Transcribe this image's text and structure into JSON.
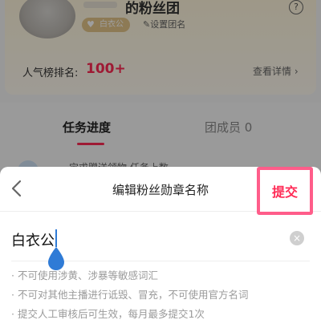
{
  "club": {
    "title": "的粉丝团",
    "badge_name": "白衣公",
    "set_name_link": "✎设置团名",
    "help_icon": "?",
    "rank_label": "人气榜排名:",
    "rank_value": "100+",
    "detail_link": "查看详情 ›"
  },
  "tabs": [
    {
      "label": "任务进度",
      "active": true
    },
    {
      "label": "团成员 0",
      "active": false
    }
  ],
  "list_peek_text": "宝求赠送领物·任务上数",
  "sheet": {
    "title": "编辑粉丝勋章名称",
    "submit_label": "提交",
    "input_value": "白衣公",
    "clear_icon": "×",
    "rules": [
      "· 不可使用涉黄、涉暴等敏感词汇",
      "· 不可对其他主播进行诋毁、冒充，不可使用官方名词",
      "· 提交人工审核后可生效，每月最多提交1次"
    ]
  },
  "colors": {
    "accent": "#ff2a55",
    "highlight_border": "#ff5d8a",
    "badge": "#e4c58a",
    "caret": "#2f7bd6"
  }
}
